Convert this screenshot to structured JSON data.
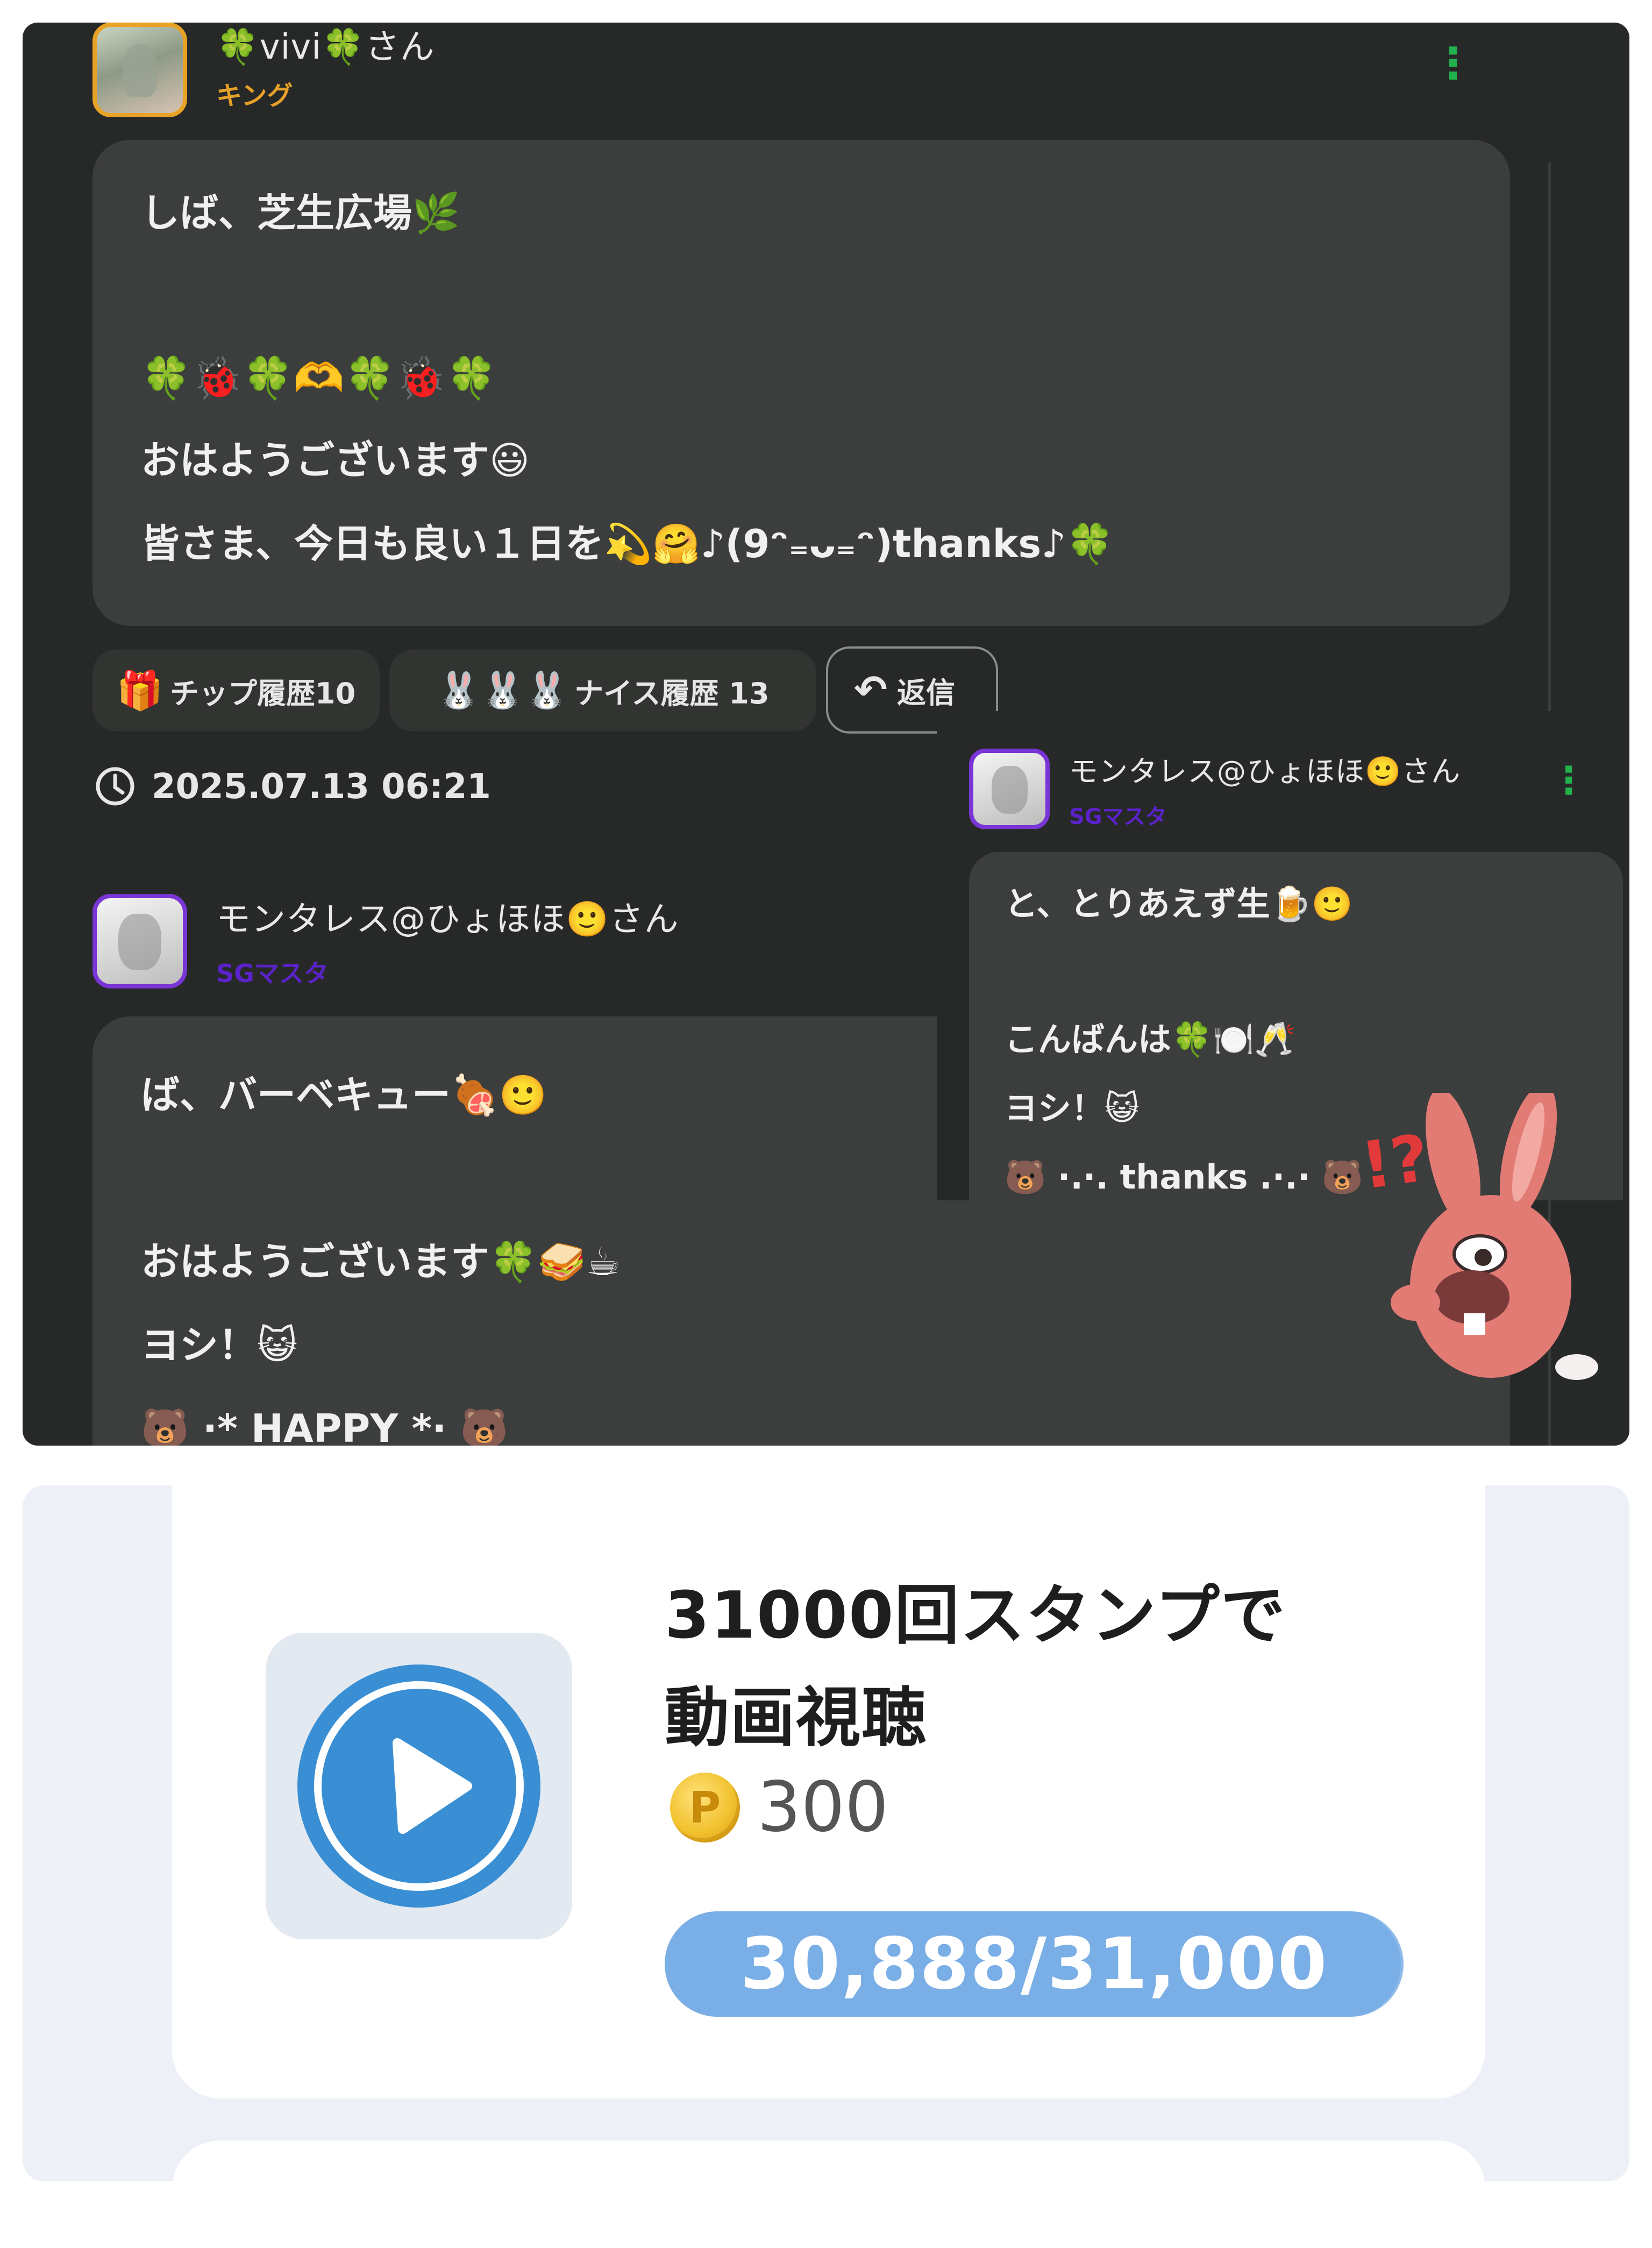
{
  "chat": {
    "post1": {
      "user_name": "🍀vivi🍀さん",
      "rank": "キング",
      "message_lines": [
        "しば、芝生広場🌿",
        "🍀🐞🍀🫶🍀🐞🍀",
        "おはようございます😃",
        "皆さま、今日も良い１日を💫🤗♪(9ᵔ₌ᴗ₌ᵔ)thanks♪🍀"
      ],
      "tip_label": "チップ履歴10",
      "nice_label": "ナイス履歴 13",
      "nice_emoji": "🐰🐰🐰",
      "reply_label": "返信",
      "timestamp": "2025.07.13 06:21"
    },
    "post2": {
      "user_name": "モンタレス@ひょほほ🙂さん",
      "rank": "SGマスタ",
      "message_lines": [
        "ば、バーベキュー🍖🙂",
        "おはようございます🍀🥪☕",
        "ヨシ！😺",
        "🐻 ·* HAPPY *· 🐻"
      ]
    },
    "overlay_post": {
      "user_name": "モンタレス@ひょほほ🙂さん",
      "rank": "SGマスタ",
      "message_lines": [
        "と、とりあえず生🍺🙂",
        "こんばんは🍀🍽️🥂",
        "ヨシ！😺",
        "🐻 ·.·. thanks .·.· 🐻"
      ]
    },
    "sticker": {
      "label": "!?",
      "name": "surprised-rabbit-sticker"
    },
    "colors": {
      "background": "#272928",
      "bubble": "#3b3e3c",
      "rank_king": "#e6a12a",
      "rank_master": "#5b22c9",
      "menu": "#22b14c"
    }
  },
  "stamp": {
    "title_line1": "31000回スタンプで",
    "title_line2": "動画視聴",
    "coin_symbol": "P",
    "coin_amount": "300",
    "progress_text": "30,888/31,000",
    "progress_fraction": 0.9964,
    "icon": "play-icon",
    "colors": {
      "play": "#3a8fd4",
      "progress": "#7aaee6"
    }
  }
}
